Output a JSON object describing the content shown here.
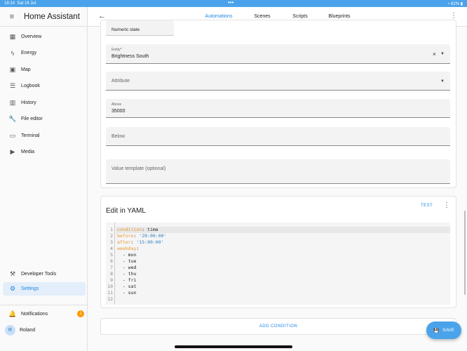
{
  "status_bar": {
    "time": "18:14",
    "date": "Sat 16 Jul",
    "battery": "62%"
  },
  "sidebar": {
    "title": "Home Assistant",
    "items": [
      {
        "label": "Overview",
        "icon": "▦"
      },
      {
        "label": "Energy",
        "icon": "ϟ"
      },
      {
        "label": "Map",
        "icon": "▣"
      },
      {
        "label": "Logbook",
        "icon": "☰"
      },
      {
        "label": "History",
        "icon": "▥"
      },
      {
        "label": "File editor",
        "icon": "🔧"
      },
      {
        "label": "Terminal",
        "icon": "▭"
      },
      {
        "label": "Media",
        "icon": "▶"
      }
    ],
    "developer_tools": "Developer Tools",
    "settings": "Settings",
    "notifications": "Notifications",
    "notification_count": "1",
    "user": "Roland",
    "avatar_initial": "R"
  },
  "tabs": [
    "Automations",
    "Scenes",
    "Scripts",
    "Blueprints"
  ],
  "condition_card": {
    "type_select": "Numeric state",
    "entity_label": "Entity*",
    "entity_value": "Brightness South",
    "attribute_placeholder": "Attribute",
    "above_label": "Above",
    "above_value": "35000",
    "below_placeholder": "Below",
    "value_template_placeholder": "Value template (optional)"
  },
  "yaml_card": {
    "title": "Edit in YAML",
    "test_label": "TEST",
    "lines": [
      {
        "n": "1",
        "key": "condition",
        "rest": " time"
      },
      {
        "n": "2",
        "key": "before",
        "str": " '20:00:00'"
      },
      {
        "n": "3",
        "key": "after",
        "str": " '15:00:00'"
      },
      {
        "n": "4",
        "key": "weekday",
        "rest": ""
      },
      {
        "n": "5",
        "rest": "  - mon"
      },
      {
        "n": "6",
        "rest": "  - tue"
      },
      {
        "n": "7",
        "rest": "  - wed"
      },
      {
        "n": "8",
        "rest": "  - thu"
      },
      {
        "n": "9",
        "rest": "  - fri"
      },
      {
        "n": "10",
        "rest": "  - sat"
      },
      {
        "n": "11",
        "rest": "  - sun"
      },
      {
        "n": "12",
        "rest": ""
      }
    ]
  },
  "add_condition": "ADD CONDITION",
  "save": "SAVE"
}
